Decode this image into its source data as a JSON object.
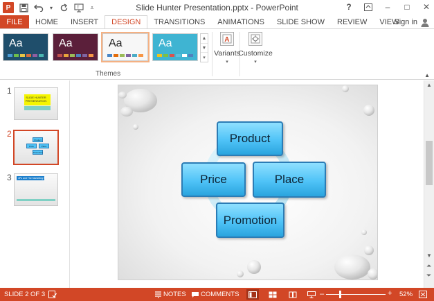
{
  "window": {
    "title": "Slide Hunter  Presentation.pptx - PowerPoint",
    "app_logo": "P"
  },
  "qat": {
    "save_icon": "save-icon",
    "undo_icon": "undo-icon",
    "redo_icon": "repeat-icon",
    "start_icon": "start-from-beginning-icon",
    "customize_icon": "customize-qat-icon"
  },
  "window_controls": {
    "help": "?",
    "minimize": "–",
    "restore": "□",
    "close": "✕"
  },
  "tabs": {
    "file": "FILE",
    "items": [
      "HOME",
      "INSERT",
      "DESIGN",
      "TRANSITIONS",
      "ANIMATIONS",
      "SLIDE SHOW",
      "REVIEW",
      "VIEW"
    ],
    "active": "DESIGN"
  },
  "account": {
    "signin": "Sign in"
  },
  "ribbon": {
    "themes_label": "Themes",
    "themes": [
      {
        "text": "Aa",
        "bg": "#1f4e6b",
        "fg": "#ffffff",
        "swatches": [
          "#4a9bd4",
          "#6dbf4b",
          "#e8c547",
          "#d66b3c",
          "#8e5ea2",
          "#49b6b0"
        ]
      },
      {
        "text": "Aa",
        "bg": "#5b1f3a",
        "fg": "#ffffff",
        "swatches": [
          "#c0504d",
          "#e8a33c",
          "#9bbb59",
          "#4f81bd",
          "#8064a2",
          "#f79646"
        ]
      },
      {
        "text": "Aa",
        "bg": "#f7f7f7",
        "fg": "#222222",
        "swatches": [
          "#4a86c5",
          "#e36c0a",
          "#9bbb59",
          "#8064a2",
          "#4bacc6",
          "#f79646"
        ]
      },
      {
        "text": "Aa",
        "bg": "#3fb4d2",
        "fg": "#ffffff",
        "swatches": [
          "#f0c419",
          "#7bc043",
          "#d9534f",
          "#5bc0de",
          "#ffffff",
          "#4f81bd"
        ]
      }
    ],
    "variants": "Variants",
    "customize": "Customize"
  },
  "thumbnails": [
    {
      "number": "1",
      "title_line1": "SLIDE HUNTER",
      "title_line2": "PRESENTATION"
    },
    {
      "number": "2",
      "shapes": [
        "Product",
        "Price",
        "Place",
        "Promotion"
      ]
    },
    {
      "number": "3",
      "heading": "4Ps and The Marketing Mix"
    }
  ],
  "slide": {
    "shapes": {
      "top": "Product",
      "left": "Price",
      "right": "Place",
      "bottom": "Promotion"
    }
  },
  "status": {
    "slide_info": "SLIDE 2 OF 3",
    "notes": "NOTES",
    "comments": "COMMENTS",
    "zoom": "52%",
    "zoom_level": 0.52
  },
  "colors": {
    "accent": "#d24726",
    "shape_fill": "#4fc3f7",
    "shape_border": "#2b7cb5"
  }
}
